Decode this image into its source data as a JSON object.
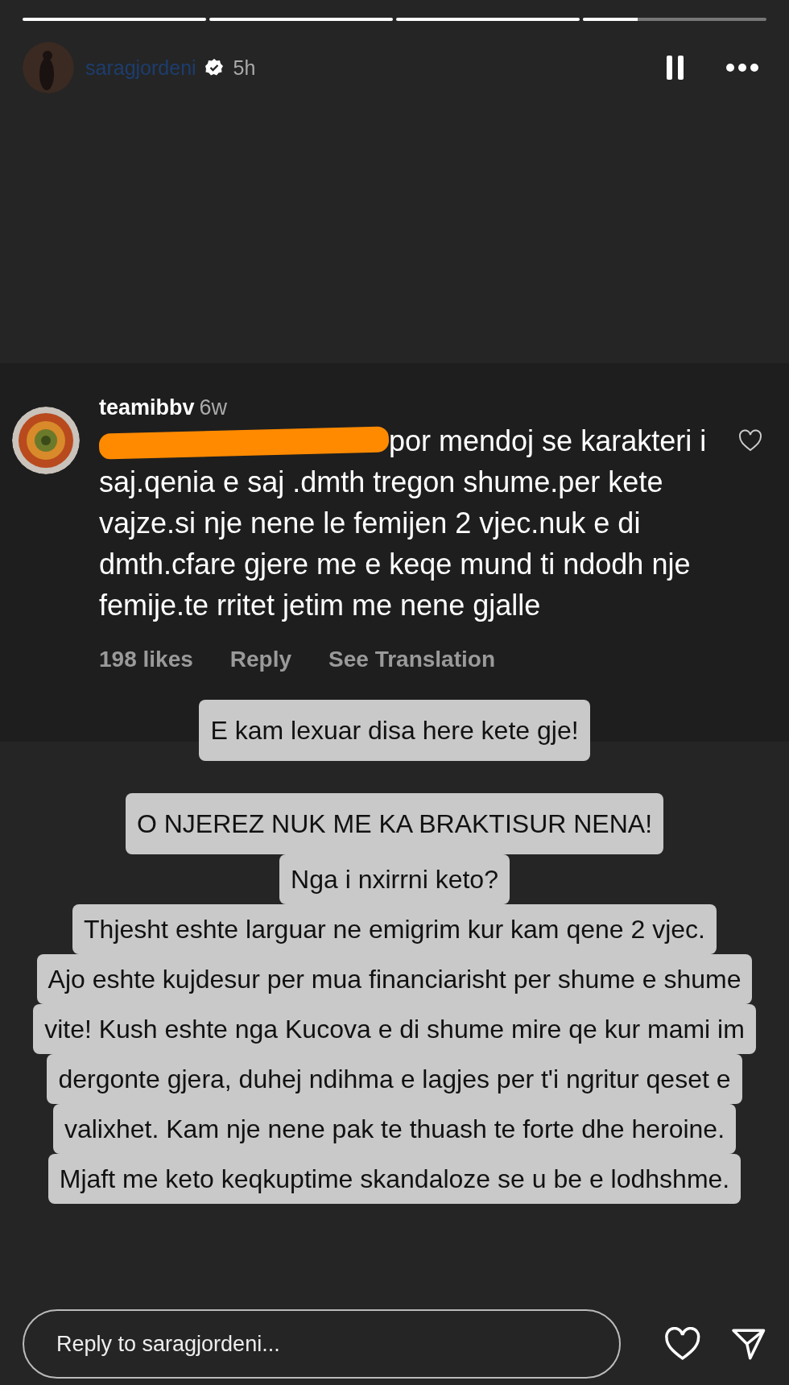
{
  "story": {
    "segments": [
      {
        "level": 1
      },
      {
        "level": 1
      },
      {
        "level": 1
      },
      {
        "level": 0.3
      }
    ],
    "author": {
      "username": "saragjordeni",
      "time": "5h"
    }
  },
  "comment": {
    "username": "teamibbv",
    "time": "6w",
    "redacted": true,
    "text": "por mendoj se karakteri i saj.qenia e saj .dmth tregon shume.per kete vajze.si nje nene le femijen 2 vjec.nuk e di dmth.cfare gjere me e keqe mund ti ndodh nje femije.te rritet jetim me nene gjalle",
    "likes": "198 likes",
    "reply": "Reply",
    "translate": "See Translation"
  },
  "captions": [
    {
      "lines": [
        "E kam lexuar disa here kete gje!"
      ]
    },
    {
      "lines": [
        "O NJEREZ NUK ME KA BRAKTISUR NENA!",
        "Nga i nxirrni keto?",
        "Thjesht eshte larguar ne emigrim kur kam qene 2 vjec.",
        "Ajo eshte kujdesur per mua financiarisht per shume e shume",
        "vite! Kush eshte nga Kucova e di shume mire qe kur mami im",
        "dergonte gjera, duhej ndihma e lagjes per t'i ngritur qeset e",
        "valixhet. Kam nje nene pak te thuash te forte dhe heroine.",
        "Mjaft me keto keqkuptime skandaloze se u be e lodhshme."
      ]
    }
  ],
  "reply_field": {
    "placeholder": "Reply to saragjordeni..."
  }
}
